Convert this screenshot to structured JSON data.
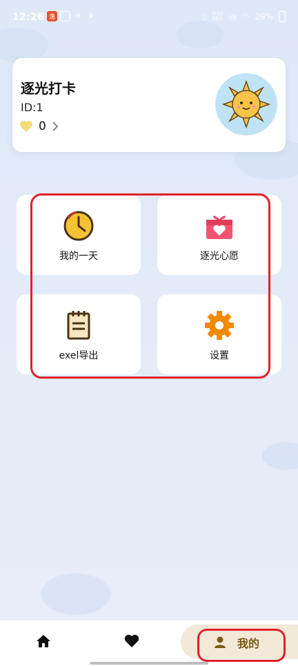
{
  "status_bar": {
    "time": "12:26",
    "net_rate_top": "0.10",
    "net_rate_bottom": "KB/s",
    "battery": "29%"
  },
  "profile": {
    "app_title": "逐光打卡",
    "user_id": "ID:1",
    "points": "0"
  },
  "menu": {
    "items": [
      {
        "label": "我的一天",
        "icon": "clock-icon"
      },
      {
        "label": "逐光心愿",
        "icon": "gift-heart-icon"
      },
      {
        "label": "exel导出",
        "icon": "notepad-icon"
      },
      {
        "label": "设置",
        "icon": "gear-icon"
      }
    ]
  },
  "bottom_nav": {
    "home_icon": "home-icon",
    "like_icon": "heart-icon",
    "mine_label": "我的"
  },
  "colors": {
    "outline_red": "#e0202a",
    "gear_orange": "#f08a00",
    "gift_pink": "#f0556f",
    "clock_yellow": "#f5c233",
    "mine_text": "#7a5a12"
  }
}
